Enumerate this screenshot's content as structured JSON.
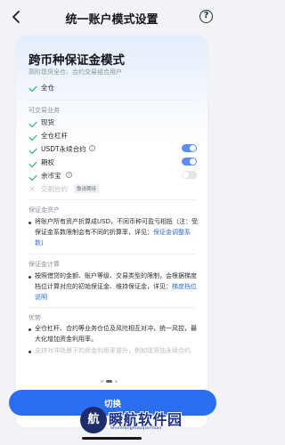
{
  "header": {
    "title": "统一账户模式设置",
    "back_icon": "chevron-left-icon",
    "help_icon": "help-circle-icon",
    "help_glyph": "?"
  },
  "card": {
    "mode_title": "跨币种保证金模式",
    "mode_subtitle": "高阶现货全仓、合约交易组合用户",
    "margin_type": "全仓",
    "tradable_section": "可交易业务",
    "businesses": [
      {
        "label": "现货",
        "status": "check"
      },
      {
        "label": "全仓杠杆",
        "status": "check"
      },
      {
        "label": "USDT永续合约",
        "status": "check",
        "info": true,
        "toggle": "on"
      },
      {
        "label": "期权",
        "status": "check",
        "toggle": "on"
      },
      {
        "label": "余币宝",
        "status": "check",
        "info": true,
        "toggle": "off"
      },
      {
        "label": "交割合约",
        "status": "cross",
        "badge": "敬请期待"
      }
    ],
    "margin_assets_section": "保证金资产",
    "margin_assets_text": "将账户所有资产折算成USD，不同币种可盈亏相抵（注：受保证金系数限制会有不同的折算率，详见：",
    "margin_assets_link": "保证金调整系数",
    "margin_assets_end": "）",
    "margin_calc_section": "保证金计算",
    "margin_calc_text": "按照借贷的金额、账户等级、交易类型的限制，会根据梯度档位计算对应的初始保证金、维持保证金，详见：",
    "margin_calc_link": "梯度档位说明",
    "advantages_section": "优势",
    "advantages_text": "全仓杠杆、合约等业务仓位及风险相互对冲，统一风控，最大化增加资金利用率。",
    "advantages_cut_text": "支持对冲场景下的资金利用率提升，例如现货加永续合约"
  },
  "pager": {
    "count": 3,
    "active": 1
  },
  "footer": {
    "switch_label": "切换"
  },
  "watermark": {
    "glyph": "航",
    "text": "瞬航软件园",
    "sub": "ShunHangRuanJianYuan"
  },
  "colors": {
    "accent": "#2b6ff0",
    "check": "#1da862",
    "toggle_on": "#5b8ef3"
  }
}
